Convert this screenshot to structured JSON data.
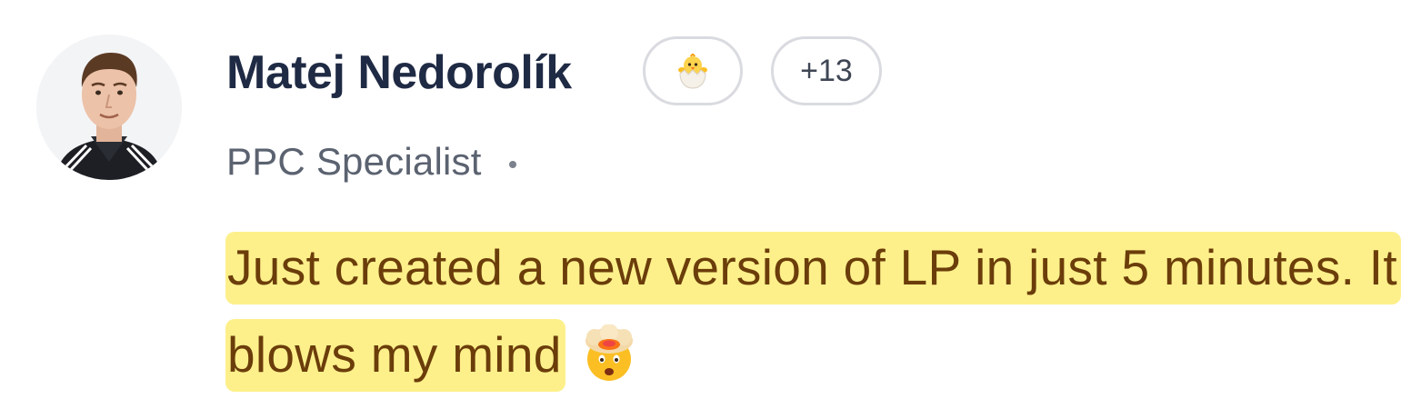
{
  "user": {
    "name": "Matej Nedorolík",
    "role": "PPC Specialist"
  },
  "badges": {
    "emoji_icon": "hatching-chick-icon",
    "more_count": "+13"
  },
  "message": {
    "text": "Just created a new version of LP in just 5 minutes. It blows my mind",
    "trailing_emoji_icon": "exploding-head-icon",
    "highlight_color": "#fdf08b",
    "text_color": "#6b3d0a"
  },
  "colors": {
    "name": "#1f2a44",
    "role": "#5b6270",
    "pill_border": "#d9dbe0"
  }
}
